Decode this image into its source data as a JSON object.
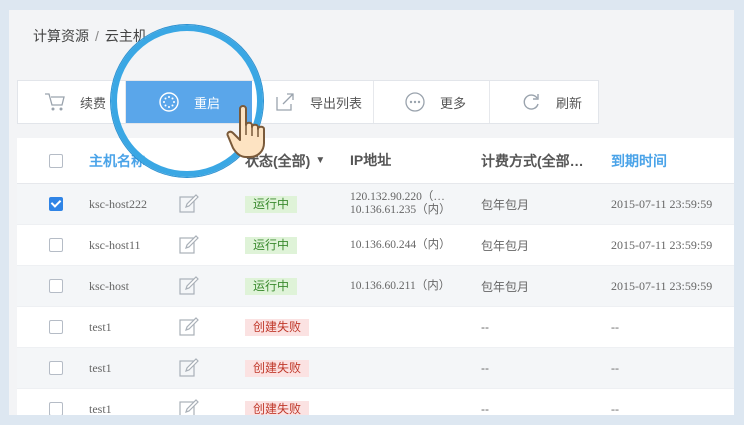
{
  "breadcrumb": {
    "section": "计算资源",
    "separator": "/",
    "current": "云主机"
  },
  "toolbar": {
    "renew_label": "续费",
    "restart_label": "重启",
    "export_label": "导出列表",
    "more_label": "更多",
    "refresh_label": "刷新"
  },
  "table": {
    "headers": {
      "name": "主机名称",
      "status": "状态(全部)",
      "ip": "IP地址",
      "billing": "计费方式(全部…",
      "expire": "到期时间"
    },
    "rows": [
      {
        "checked": true,
        "name": "ksc-host222",
        "status": "运行中",
        "status_type": "run",
        "ip1": "120.132.90.220（…",
        "ip2": "10.136.61.235（内）",
        "billing": "包年包月",
        "expire": "2015-07-11 23:59:59"
      },
      {
        "checked": false,
        "name": "ksc-host11",
        "status": "运行中",
        "status_type": "run",
        "ip1": "10.136.60.244（内）",
        "ip2": "",
        "billing": "包年包月",
        "expire": "2015-07-11 23:59:59"
      },
      {
        "checked": false,
        "name": "ksc-host",
        "status": "运行中",
        "status_type": "run",
        "ip1": "10.136.60.211（内）",
        "ip2": "",
        "billing": "包年包月",
        "expire": "2015-07-11 23:59:59"
      },
      {
        "checked": false,
        "name": "test1",
        "status": "创建失败",
        "status_type": "fail",
        "ip1": "",
        "ip2": "",
        "billing": "--",
        "expire": "--"
      },
      {
        "checked": false,
        "name": "test1",
        "status": "创建失败",
        "status_type": "fail",
        "ip1": "",
        "ip2": "",
        "billing": "--",
        "expire": "--"
      },
      {
        "checked": false,
        "name": "test1",
        "status": "创建失败",
        "status_type": "fail",
        "ip1": "",
        "ip2": "",
        "billing": "--",
        "expire": "--"
      }
    ]
  },
  "icons": {
    "renew": "cart-icon",
    "restart": "restart-icon",
    "export": "export-icon",
    "more": "more-icon",
    "refresh": "refresh-icon",
    "edit": "edit-icon",
    "pointer": "hand-pointer-icon"
  },
  "colors": {
    "accent": "#5aa6ea",
    "link": "#4aa3e8",
    "running_bg": "#dff3d8",
    "failed_bg": "#fbe2e2",
    "highlight_ring": "#3aa7e4"
  }
}
